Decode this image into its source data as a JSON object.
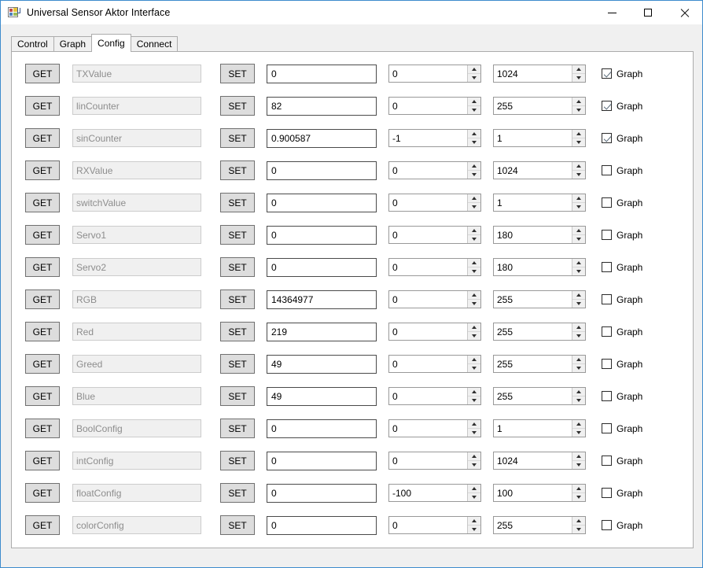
{
  "window": {
    "title": "Universal Sensor Aktor Interface",
    "icon": "application-icon",
    "controls": {
      "minimize": "minimize-button",
      "maximize": "maximize-button",
      "close": "close-button"
    }
  },
  "tabs": [
    {
      "label": "Control",
      "active": false
    },
    {
      "label": "Graph",
      "active": false
    },
    {
      "label": "Config",
      "active": true
    },
    {
      "label": "Connect",
      "active": false
    }
  ],
  "labels": {
    "get": "GET",
    "set": "SET",
    "graph": "Graph"
  },
  "colors": {
    "window_border": "#3d8bcd",
    "button_face": "#dddddd",
    "panel_background": "#ffffff",
    "disabled_text": "#8d8d8d",
    "check_mark": "#5a6b7a"
  },
  "rows": [
    {
      "get": "GET",
      "name": "TXValue",
      "set": "SET",
      "value": "0",
      "min": "0",
      "max": "1024",
      "graph_label": "Graph",
      "graph_checked": true
    },
    {
      "get": "GET",
      "name": "linCounter",
      "set": "SET",
      "value": "82",
      "min": "0",
      "max": "255",
      "graph_label": "Graph",
      "graph_checked": true
    },
    {
      "get": "GET",
      "name": "sinCounter",
      "set": "SET",
      "value": "0.900587",
      "min": "-1",
      "max": "1",
      "graph_label": "Graph",
      "graph_checked": true
    },
    {
      "get": "GET",
      "name": "RXValue",
      "set": "SET",
      "value": "0",
      "min": "0",
      "max": "1024",
      "graph_label": "Graph",
      "graph_checked": false
    },
    {
      "get": "GET",
      "name": "switchValue",
      "set": "SET",
      "value": "0",
      "min": "0",
      "max": "1",
      "graph_label": "Graph",
      "graph_checked": false
    },
    {
      "get": "GET",
      "name": "Servo1",
      "set": "SET",
      "value": "0",
      "min": "0",
      "max": "180",
      "graph_label": "Graph",
      "graph_checked": false
    },
    {
      "get": "GET",
      "name": "Servo2",
      "set": "SET",
      "value": "0",
      "min": "0",
      "max": "180",
      "graph_label": "Graph",
      "graph_checked": false
    },
    {
      "get": "GET",
      "name": "RGB",
      "set": "SET",
      "value": "14364977",
      "min": "0",
      "max": "255",
      "graph_label": "Graph",
      "graph_checked": false
    },
    {
      "get": "GET",
      "name": "Red",
      "set": "SET",
      "value": "219",
      "min": "0",
      "max": "255",
      "graph_label": "Graph",
      "graph_checked": false
    },
    {
      "get": "GET",
      "name": "Greed",
      "set": "SET",
      "value": "49",
      "min": "0",
      "max": "255",
      "graph_label": "Graph",
      "graph_checked": false
    },
    {
      "get": "GET",
      "name": "Blue",
      "set": "SET",
      "value": "49",
      "min": "0",
      "max": "255",
      "graph_label": "Graph",
      "graph_checked": false
    },
    {
      "get": "GET",
      "name": "BoolConfig",
      "set": "SET",
      "value": "0",
      "min": "0",
      "max": "1",
      "graph_label": "Graph",
      "graph_checked": false
    },
    {
      "get": "GET",
      "name": "intConfig",
      "set": "SET",
      "value": "0",
      "min": "0",
      "max": "1024",
      "graph_label": "Graph",
      "graph_checked": false
    },
    {
      "get": "GET",
      "name": "floatConfig",
      "set": "SET",
      "value": "0",
      "min": "-100",
      "max": "100",
      "graph_label": "Graph",
      "graph_checked": false
    },
    {
      "get": "GET",
      "name": "colorConfig",
      "set": "SET",
      "value": "0",
      "min": "0",
      "max": "255",
      "graph_label": "Graph",
      "graph_checked": false
    }
  ]
}
